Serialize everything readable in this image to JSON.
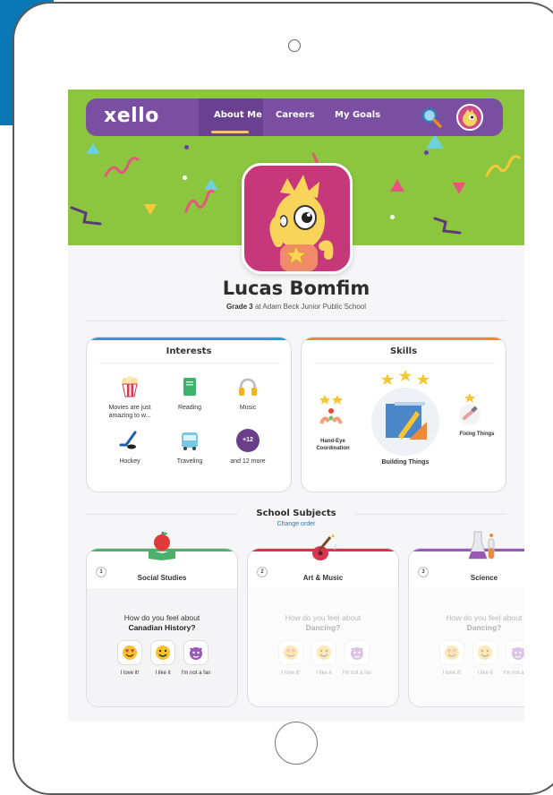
{
  "app": {
    "logo": "xello"
  },
  "nav": {
    "links": [
      "About Me",
      "Careers",
      "My Goals"
    ]
  },
  "profile": {
    "name": "Lucas Bomfim",
    "grade": "Grade 3",
    "school": "at Adam Beck Junior Public School"
  },
  "interests": {
    "title": "Interests",
    "items": [
      {
        "label": "Movies are just amazing to w...",
        "icon": "popcorn-icon"
      },
      {
        "label": "Reading",
        "icon": "book-icon"
      },
      {
        "label": "Music",
        "icon": "headphones-icon"
      },
      {
        "label": "Hockey",
        "icon": "hockey-stick-icon"
      },
      {
        "label": "Traveling",
        "icon": "bus-icon"
      },
      {
        "label": "and 12 more",
        "icon": "more-icon",
        "badge": "+12"
      }
    ]
  },
  "skills": {
    "title": "Skills",
    "items": [
      {
        "label": "Hand-Eye Coordination",
        "icon": "hands-icon"
      },
      {
        "label": "Building Things",
        "icon": "blueprint-icon"
      },
      {
        "label": "Fixing Things",
        "icon": "wrench-hand-icon"
      }
    ]
  },
  "subjects": {
    "title": "School Subjects",
    "change_order": "Change order",
    "items": [
      {
        "num": "1",
        "name": "Social Studies",
        "question": "How do you feel about",
        "topic": "Canadian History?",
        "color": "#4cb26b"
      },
      {
        "num": "2",
        "name": "Art & Music",
        "question": "How do you feel about",
        "topic": "Dancing?",
        "color": "#d9344e"
      },
      {
        "num": "3",
        "name": "Science",
        "question": "How do you feel about",
        "topic": "Dancing?",
        "color": "#9b59b6"
      }
    ],
    "reactions": [
      "I love it!",
      "I like it",
      "I'm not a fan"
    ]
  },
  "colors": {
    "hero": "#8cc63f",
    "nav": "#7a4fa1",
    "interests_accent": "#2f9ad6",
    "skills_accent": "#f0883a"
  }
}
